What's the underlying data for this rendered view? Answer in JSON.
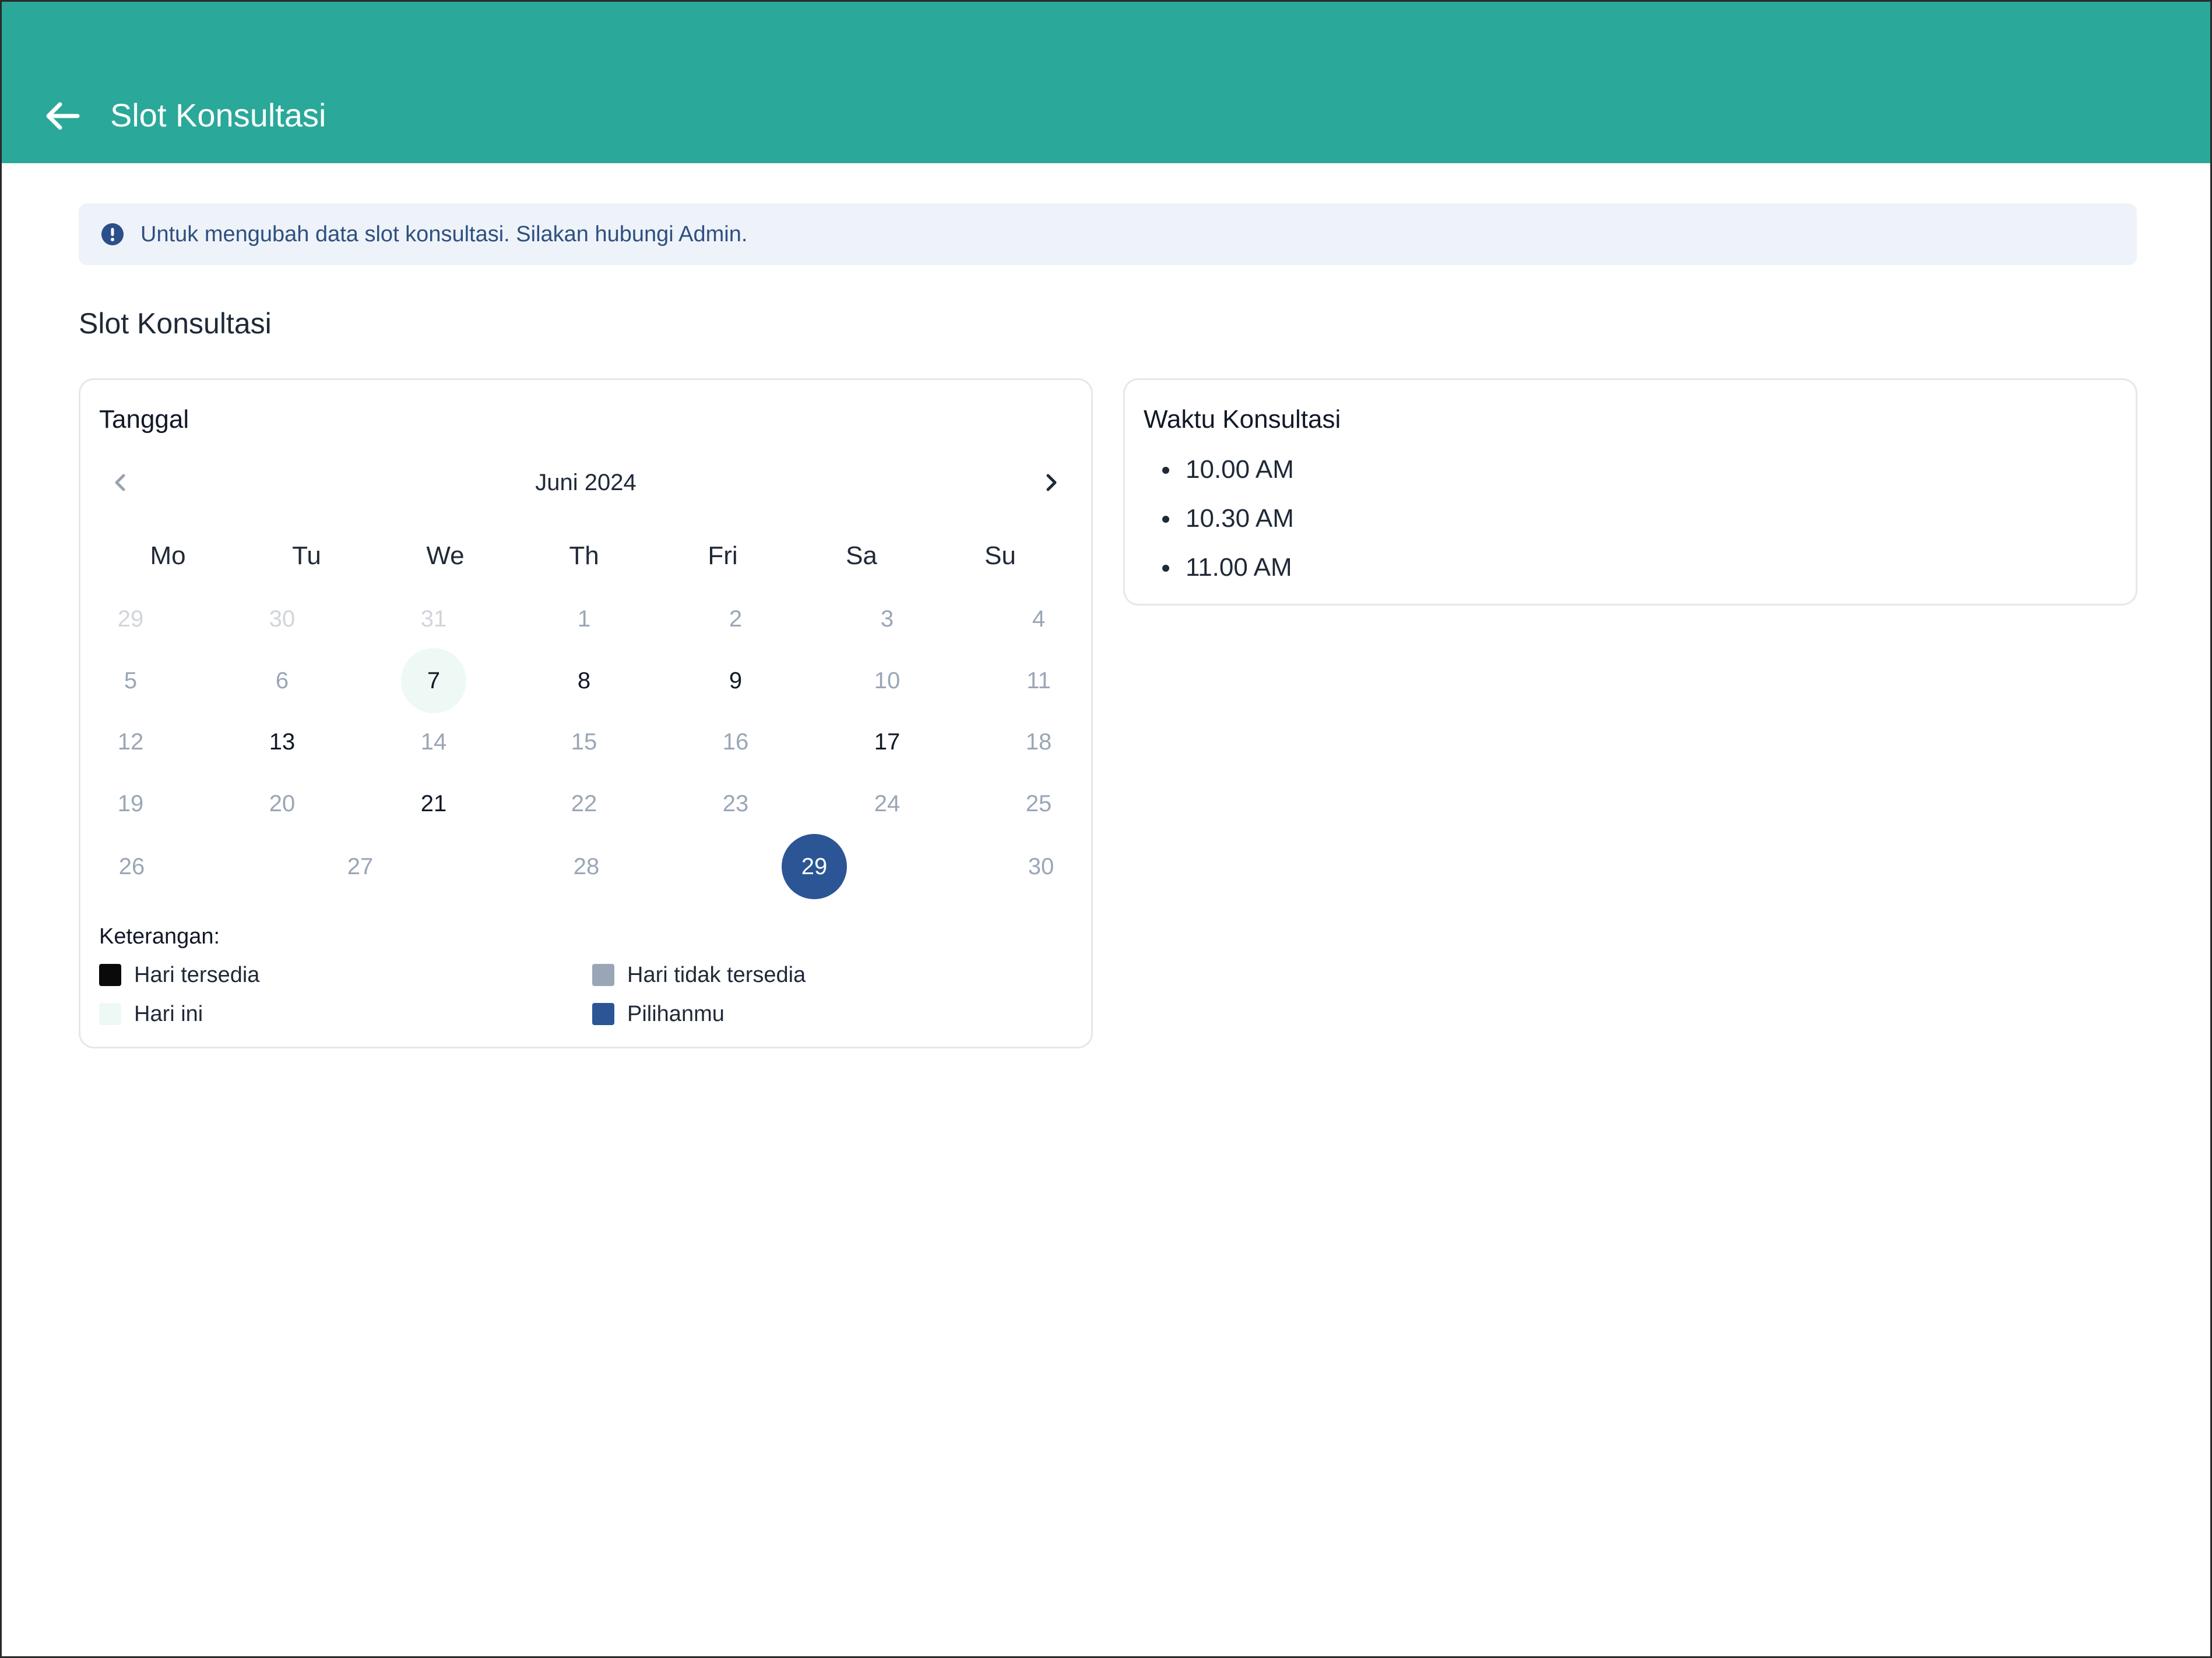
{
  "header": {
    "title": "Slot Konsultasi",
    "back_icon": "arrow-left-icon"
  },
  "alert": {
    "icon": "info-circle-icon",
    "text": "Untuk mengubah data slot konsultasi. Silakan hubungi Admin."
  },
  "section_title": "Slot Konsultasi",
  "calendar": {
    "title": "Tanggal",
    "month_label": "Juni 2024",
    "prev_icon": "chevron-left-icon",
    "next_icon": "chevron-right-icon",
    "weekdays": [
      "Mo",
      "Tu",
      "We",
      "Th",
      "Fri",
      "Sa",
      "Su"
    ],
    "weeks": [
      [
        {
          "d": "29",
          "s": "outside"
        },
        {
          "d": "30",
          "s": "outside"
        },
        {
          "d": "31",
          "s": "outside"
        },
        {
          "d": "1",
          "s": "unavail"
        },
        {
          "d": "2",
          "s": "unavail"
        },
        {
          "d": "3",
          "s": "unavail"
        },
        {
          "d": "4",
          "s": "unavail"
        }
      ],
      [
        {
          "d": "5",
          "s": "unavail"
        },
        {
          "d": "6",
          "s": "unavail"
        },
        {
          "d": "7",
          "s": "today"
        },
        {
          "d": "8",
          "s": "avail"
        },
        {
          "d": "9",
          "s": "avail"
        },
        {
          "d": "10",
          "s": "unavail"
        },
        {
          "d": "11",
          "s": "unavail"
        }
      ],
      [
        {
          "d": "12",
          "s": "unavail"
        },
        {
          "d": "13",
          "s": "avail"
        },
        {
          "d": "14",
          "s": "unavail"
        },
        {
          "d": "15",
          "s": "unavail"
        },
        {
          "d": "16",
          "s": "unavail"
        },
        {
          "d": "17",
          "s": "avail"
        },
        {
          "d": "18",
          "s": "unavail"
        }
      ],
      [
        {
          "d": "19",
          "s": "unavail"
        },
        {
          "d": "20",
          "s": "unavail"
        },
        {
          "d": "21",
          "s": "avail"
        },
        {
          "d": "22",
          "s": "unavail"
        },
        {
          "d": "23",
          "s": "unavail"
        },
        {
          "d": "24",
          "s": "unavail"
        },
        {
          "d": "25",
          "s": "unavail"
        }
      ],
      [
        {
          "d": "26",
          "s": "unavail"
        },
        {
          "d": "27",
          "s": "unavail"
        },
        {
          "d": "28",
          "s": "unavail"
        },
        {
          "d": "29",
          "s": "selected"
        },
        {
          "d": "30",
          "s": "unavail"
        }
      ]
    ],
    "legend": {
      "title": "Keterangan:",
      "items": [
        {
          "label": "Hari tersedia",
          "color": "#0a0a0a"
        },
        {
          "label": "Hari tidak tersedia",
          "color": "#9aa6b6"
        },
        {
          "label": "Hari ini",
          "color": "#eef9f6"
        },
        {
          "label": "Pilihanmu",
          "color": "#2b5595"
        }
      ]
    }
  },
  "time_panel": {
    "title": "Waktu Konsultasi",
    "slots": [
      "10.00 AM",
      "10.30 AM",
      "11.00 AM"
    ]
  },
  "colors": {
    "header": "#2aa899",
    "selected": "#2b5595",
    "today": "#eef9f6",
    "alert_bg": "#edf3f9"
  }
}
